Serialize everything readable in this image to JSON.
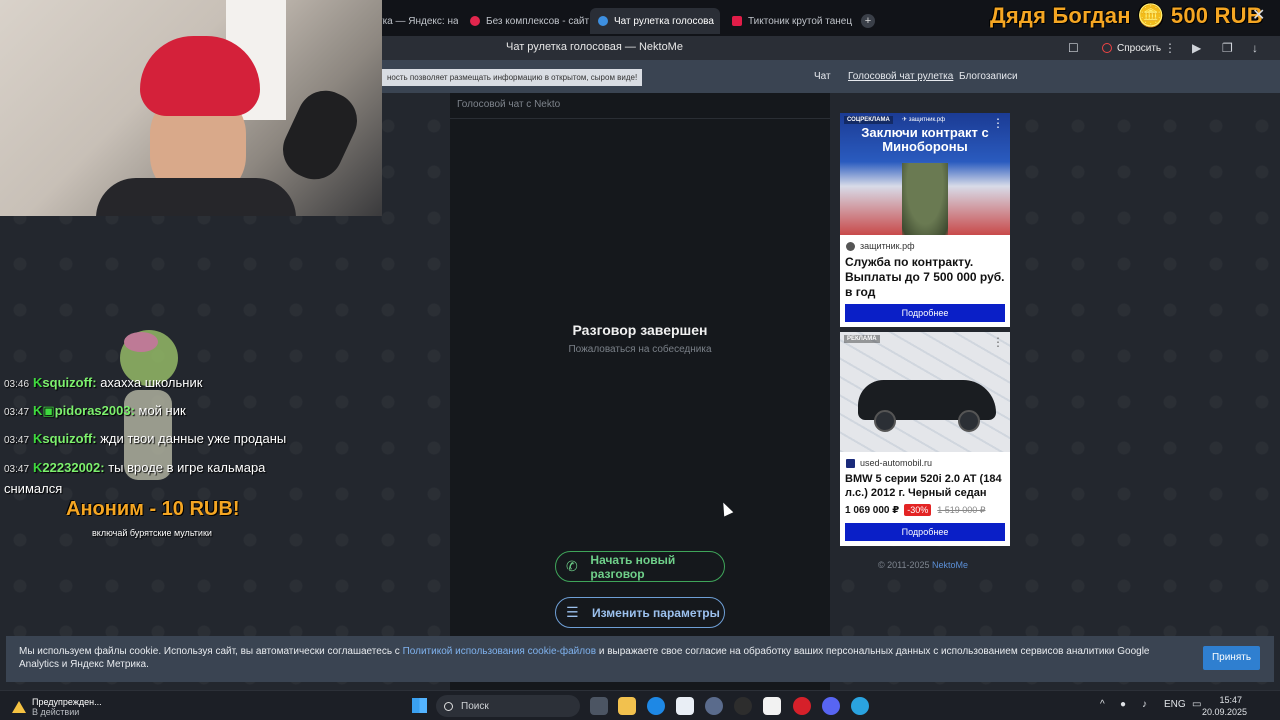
{
  "browser": {
    "tabs": [
      {
        "label": "тка — Яндекс: на",
        "color": "#9aa0a6"
      },
      {
        "label": "Без комплексов - сайт зн",
        "color": "#e2264d"
      },
      {
        "label": "Чат рулетка голосова",
        "color": "#3d8fe0",
        "active": true
      },
      {
        "label": "Тиктоник крутой танец",
        "color": "#e11d48"
      }
    ],
    "new_tab": "+",
    "page_title": "Чат рулетка голосовая — NektoMe",
    "ask_label": "Спросить"
  },
  "stream": {
    "top_donation": "Дядя Богдан 🪙 500 RUB",
    "close": "✕",
    "chat": [
      {
        "time": "03:46",
        "badge": "K",
        "user": "squizoff:",
        "text": " ахахха школьник"
      },
      {
        "time": "03:47",
        "badge": "K▣",
        "user": "pidoras2003:",
        "text": " мой ник"
      },
      {
        "time": "03:47",
        "badge": "K",
        "user": "squizoff:",
        "text": " жди твои данные уже проданы"
      },
      {
        "time": "03:47",
        "badge": "K",
        "user": "22232002:",
        "text": " ты вроде в игре кальмара снимался"
      }
    ],
    "donation_alert": "Аноним - 10 RUB!",
    "donation_message": "включай бурятские мультики"
  },
  "site": {
    "notice": "ность позволяет размещать информацию в открытом, сыром виде!",
    "nav": [
      {
        "label": "Чат",
        "active": false
      },
      {
        "label": "Голосовой чат рулетка",
        "active": true
      },
      {
        "label": "Блогозаписи",
        "active": false
      }
    ],
    "panel_header": "Голосовой чат с Nekto",
    "end_title": "Разговор завершен",
    "end_sub": "Пожаловаться на собеседника",
    "new_chat_button": "Начать новый разговор",
    "params_button": "Изменить параметры",
    "ad1": {
      "tag": "СОЦРЕКЛАМА",
      "mini_site": "✈ защитник.рф",
      "banner": "Заключи контракт с Минобороны",
      "source": "защитник.рф",
      "text": "Служба по контракту. Выплаты до 7 500 000 руб. в год",
      "button": "Подробнее"
    },
    "ad2": {
      "tag": "РЕКЛАМА",
      "source": "used-automobil.ru",
      "text": "BMW 5 серии 520i 2.0 AT (184 л.с.) 2012 г. Черный седан",
      "price": "1 069 000 ₽",
      "discount": "-30%",
      "old_price": "1 519 000 ₽",
      "button": "Подробнее"
    },
    "footer_copy": "© 2011-2025",
    "footer_link": "NektoMe",
    "ad_menu": "⋮"
  },
  "cookie": {
    "text_before": "Мы используем файлы cookie. Используя сайт, вы автоматически соглашаетесь с ",
    "link": "Политикой использования cookie-файлов",
    "text_after": " и выражаете свое согласие на обработку ваших персональных данных с использованием сервисов аналитики Google Analytics и Яндекс Метрика.",
    "accept": "Принять"
  },
  "taskbar": {
    "warning_title": "Предупрежден...",
    "warning_sub": "В действии",
    "search_placeholder": "Поиск",
    "lang": "ENG",
    "time": "15:47",
    "date": "20.09.2025"
  },
  "colors": {
    "accent_blue": "#2f7fd0",
    "green": "#3fa55a",
    "donation": "#f5a623",
    "ad_button": "#0a1fc7"
  }
}
